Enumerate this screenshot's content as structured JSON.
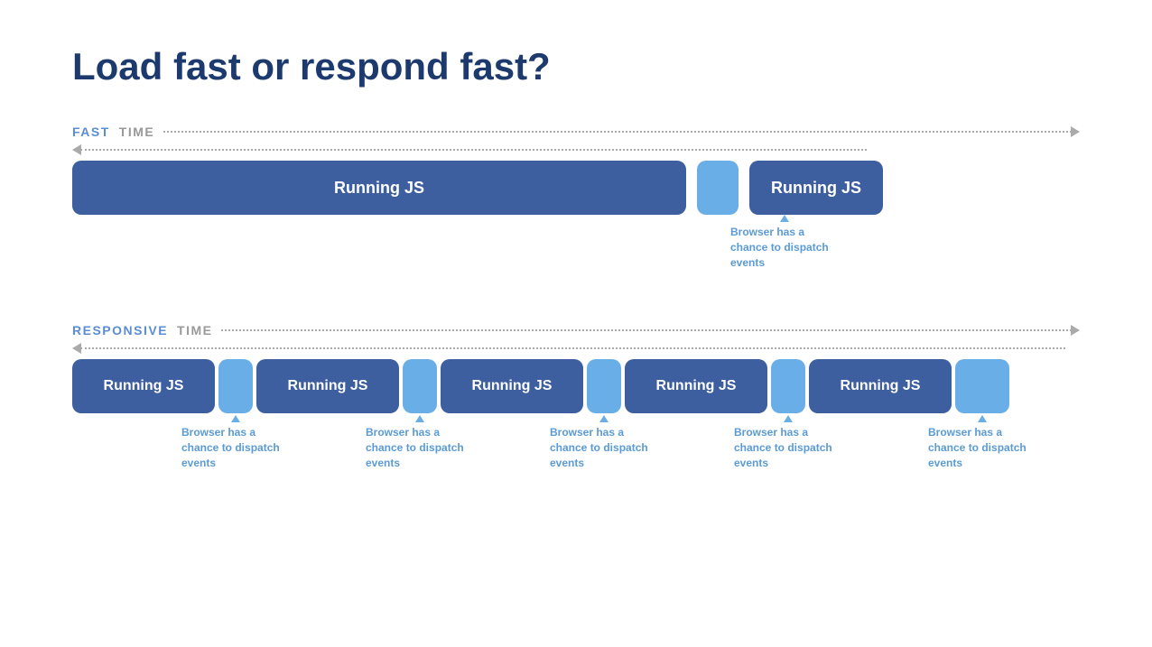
{
  "title": "Load fast or respond fast?",
  "fast_section": {
    "label": "FAST",
    "time_label": "TIME",
    "big_block_label": "Running JS",
    "second_block_label": "Running JS",
    "annotation": "Browser has a chance to dispatch events"
  },
  "responsive_section": {
    "label": "RESPONSIVE",
    "time_label": "TIME",
    "blocks": [
      "Running JS",
      "Running JS",
      "Running JS",
      "Running JS",
      "Running JS"
    ],
    "annotations": [
      "Browser has a chance to dispatch events",
      "Browser has a chance to dispatch events",
      "Browser has a chance to dispatch events",
      "Browser has a chance to dispatch events",
      "Browser has a chance to dispatch events"
    ]
  }
}
